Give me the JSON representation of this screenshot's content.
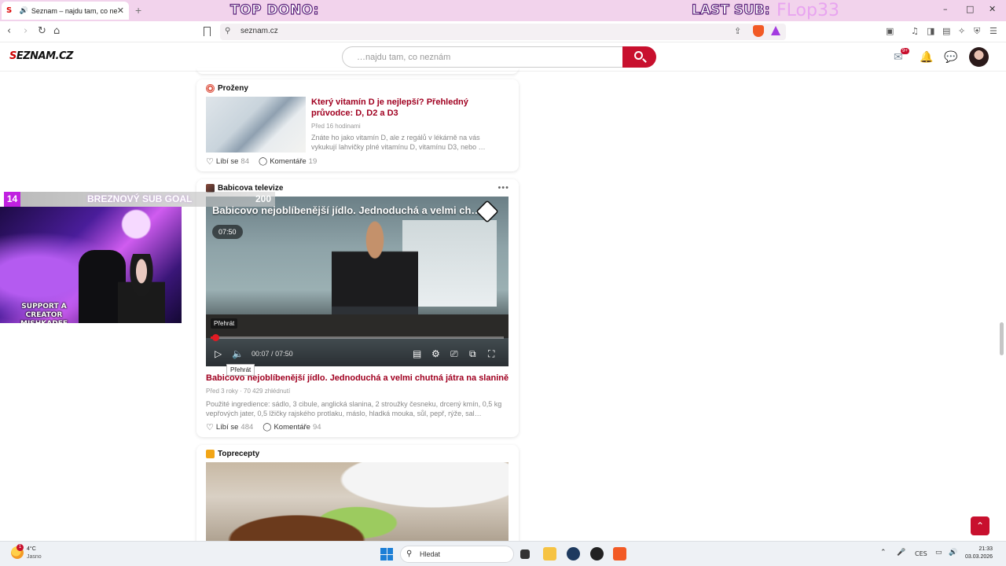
{
  "browser": {
    "tab_title": "Seznam – najdu tam, co nezn…",
    "tab_favicon": "S",
    "new_tab": "+",
    "url": "seznam.cz",
    "window": {
      "minimize": "–",
      "maximize": "□",
      "close": "✕"
    }
  },
  "stream_overlay": {
    "top_label": "TOP DONO:",
    "last_sub_label": "LAST SUB:",
    "last_sub_name": "FLop33",
    "goal_current": "14",
    "goal_label": "BREZNOVÝ SUB GOAL",
    "goal_target": "200",
    "cam_text": "SUPPORT A CREATOR MISHKADEE"
  },
  "seznam": {
    "logo_first": "S",
    "logo_rest": "EZNAM.CZ",
    "search_placeholder": "…najdu tam, co neznám",
    "mail_badge": "9+"
  },
  "article_card": {
    "source": "Proženy",
    "title": "Který vitamín D je nejlepší? Přehledný průvodce: D, D2 a D3",
    "time": "Před 16 hodinami",
    "excerpt": "Znáte ho jako vitamín D, ale z regálů v lékárně na vás vykukují lahvičky plné vitamínu D, vitamínu D3, nebo …",
    "like_label": "Líbí se",
    "likes": "84",
    "comments_label": "Komentáře",
    "comments": "19"
  },
  "video_card": {
    "source": "Babicova televize",
    "more": "•••",
    "video_overlay_title": "Babicovo nejoblíbenější jídlo. Jednoduchá a velmi chutn…",
    "duration": "07:50",
    "tooltip_top": "Přehrát",
    "tooltip_play": "Přehrát",
    "time_current": "00:07",
    "time_separator": "/",
    "time_total": "07:50",
    "progress_fraction": 0.016,
    "title": "Babicovo nejoblíbenější jídlo. Jednoduchá a velmi chutná játra na slanině",
    "time_ago": "Před 3 roky",
    "views": "70 429 zhlédnutí",
    "excerpt": "Použité ingredience: sádlo, 3 cibule, anglická slanina, 2 stroužky česneku, drcený kmín, 0,5 kg vepřových jater, 0,5 lžičky rajského protlaku, máslo, hladká mouka, sůl, pepř, rýže, sal…",
    "like_label": "Líbí se",
    "likes": "484",
    "comments_label": "Komentáře",
    "comments": "94"
  },
  "recipe_card": {
    "source": "Toprecepty"
  },
  "taskbar": {
    "temperature": "4°C",
    "condition": "Jasno",
    "weather_badge": "1",
    "search_label": "Hledat",
    "language": "CES",
    "time": "21:33",
    "date": "03.03.2026"
  },
  "colors": {
    "accent": "#c8102e",
    "title_red": "#a00020",
    "chrome_pink": "#f2d3ec",
    "goal_purple": "#c020e0"
  }
}
